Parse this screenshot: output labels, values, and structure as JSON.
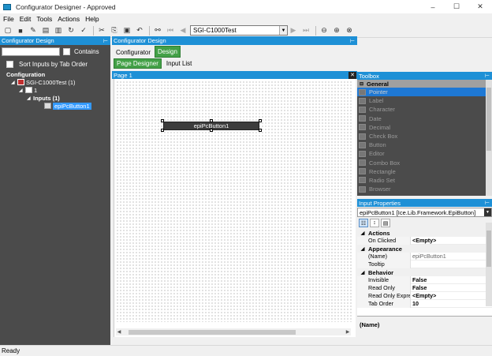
{
  "window": {
    "title": "Configurator Designer - Approved",
    "minimize": "–",
    "maximize": "☐",
    "close": "✕"
  },
  "menu": [
    "File",
    "Edit",
    "Tools",
    "Actions",
    "Help"
  ],
  "toolbar": {
    "configurator_value": "SGI-C1000Test"
  },
  "left": {
    "header": "Configurator Design",
    "contains_label": "Contains",
    "sort_label": "Sort Inputs by Tab Order",
    "tree": {
      "root": "Configuration",
      "config": "SGI-C1000Test (1)",
      "page": "1",
      "inputs": "Inputs (1)",
      "input": "epiPcButton1"
    }
  },
  "center": {
    "header": "Configurator Design",
    "tabs": [
      "Configurator",
      "Design"
    ],
    "subtabs": [
      "Page Designer",
      "Input List"
    ],
    "page_title": "Page 1",
    "canvas_button": "epiPcButton1"
  },
  "toolbox": {
    "header": "Toolbox",
    "group": "General",
    "items": [
      "Pointer",
      "Label",
      "Character",
      "Date",
      "Decimal",
      "Check Box",
      "Button",
      "Editor",
      "Combo Box",
      "Rectangle",
      "Radio Set",
      "Browser"
    ]
  },
  "properties": {
    "header": "Input Properties",
    "selected_object": "epiPcButton1 [Ice.Lib.Framework.EpiButton]",
    "categories": {
      "actions": "Actions",
      "appearance": "Appearance",
      "behavior": "Behavior"
    },
    "rows": {
      "on_clicked": {
        "key": "On Clicked",
        "value": "<Empty>"
      },
      "name": {
        "key": "(Name)",
        "value": "epiPcButton1"
      },
      "tooltip": {
        "key": "Tooltip",
        "value": ""
      },
      "invisible": {
        "key": "Invisible",
        "value": "False"
      },
      "read_only": {
        "key": "Read Only",
        "value": "False"
      },
      "read_only_expr": {
        "key": "Read Only Expression",
        "value": "<Empty>"
      },
      "tab_order": {
        "key": "Tab Order",
        "value": "10"
      }
    },
    "description_title": "(Name)"
  },
  "status": "Ready"
}
